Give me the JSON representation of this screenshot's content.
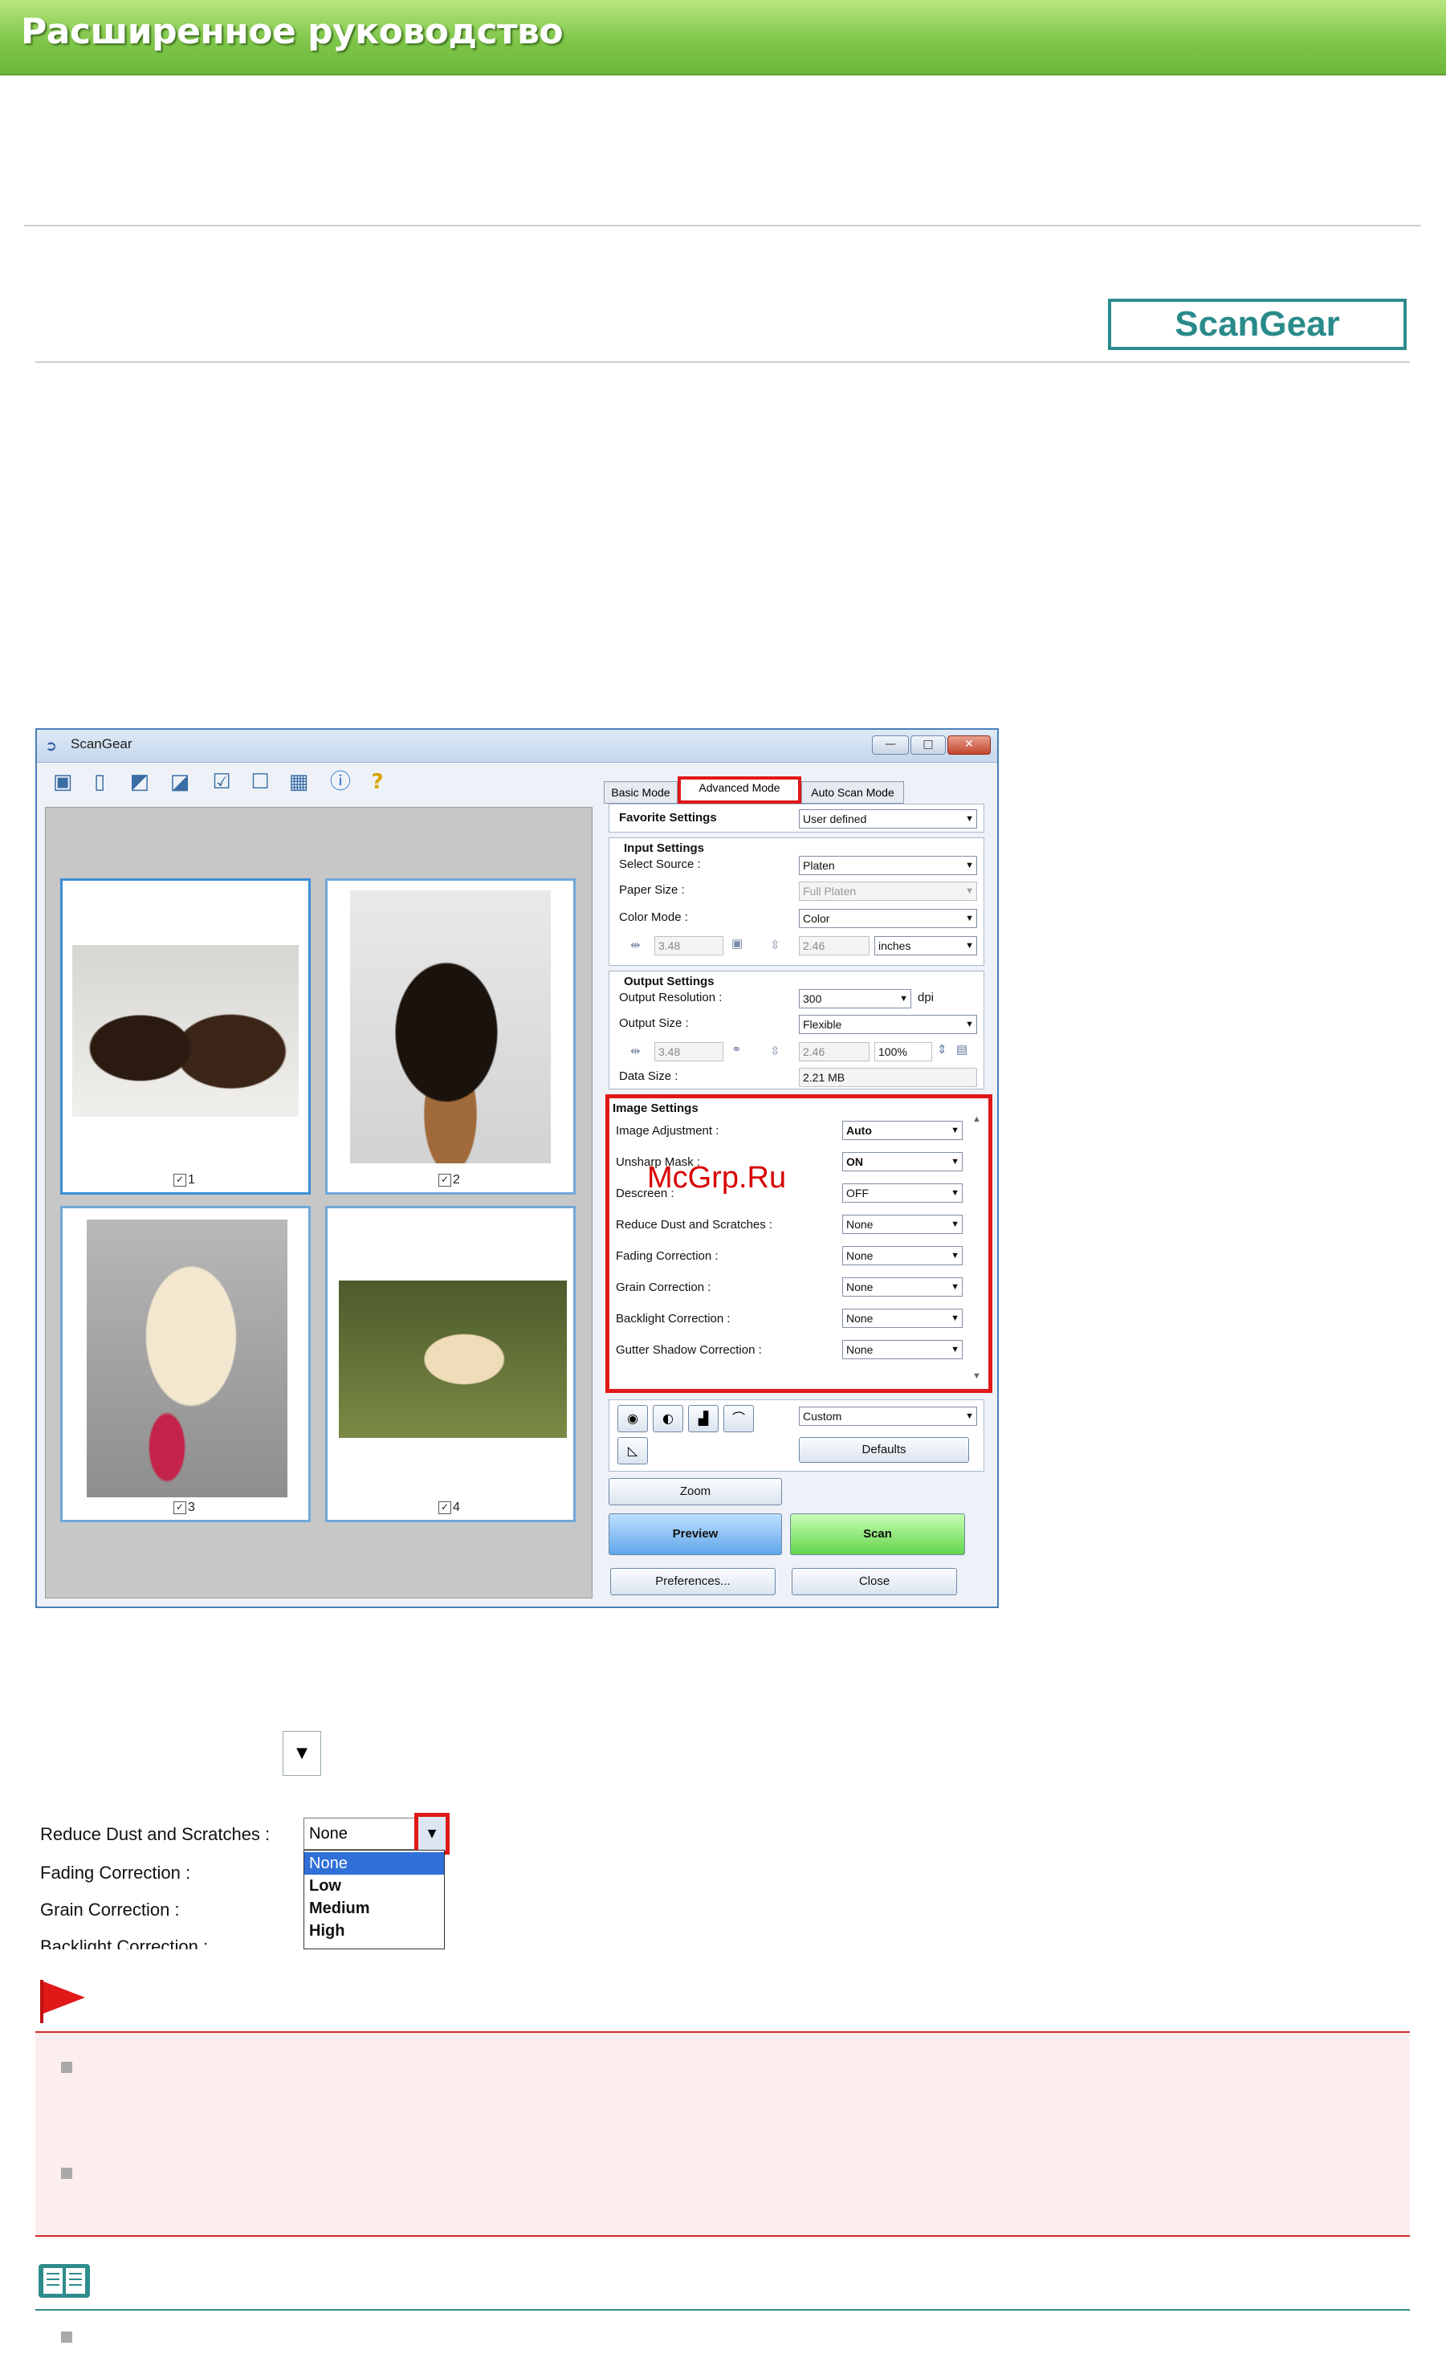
{
  "header": {
    "title": "Расширенное руководство"
  },
  "badge": {
    "label": "ScanGear"
  },
  "window": {
    "title": "ScanGear",
    "tabs": [
      "Basic Mode",
      "Advanced Mode",
      "Auto Scan Mode"
    ],
    "thumbnails": [
      {
        "check": "1"
      },
      {
        "check": "2"
      },
      {
        "check": "3"
      },
      {
        "check": "4"
      }
    ],
    "favorite": {
      "label": "Favorite Settings",
      "value": "User defined"
    },
    "input_settings": {
      "heading": "Input Settings",
      "select_source": {
        "label": "Select Source :",
        "value": "Platen"
      },
      "paper_size": {
        "label": "Paper Size :",
        "value": "Full Platen"
      },
      "color_mode": {
        "label": "Color Mode :",
        "value": "Color"
      },
      "width": "3.48",
      "height": "2.46",
      "unit": "inches"
    },
    "output_settings": {
      "heading": "Output Settings",
      "resolution": {
        "label": "Output Resolution :",
        "value": "300",
        "unit": "dpi"
      },
      "size": {
        "label": "Output Size :",
        "value": "Flexible"
      },
      "width": "3.48",
      "height": "2.46",
      "scale": "100%",
      "data_size": {
        "label": "Data Size :",
        "value": "2.21 MB"
      }
    },
    "image_settings": {
      "heading": "Image Settings",
      "rows": [
        {
          "label": "Image Adjustment :",
          "value": "Auto"
        },
        {
          "label": "Unsharp Mask :",
          "value": "ON"
        },
        {
          "label": "Descreen :",
          "value": "OFF"
        },
        {
          "label": "Reduce Dust and Scratches :",
          "value": "None"
        },
        {
          "label": "Fading Correction :",
          "value": "None"
        },
        {
          "label": "Grain Correction :",
          "value": "None"
        },
        {
          "label": "Backlight Correction :",
          "value": "None"
        },
        {
          "label": "Gutter Shadow Correction :",
          "value": "None"
        }
      ]
    },
    "tone": {
      "value": "Custom",
      "defaults": "Defaults"
    },
    "buttons": {
      "zoom": "Zoom",
      "preview": "Preview",
      "scan": "Scan",
      "preferences": "Preferences...",
      "close": "Close"
    }
  },
  "watermark": "McGrp.Ru",
  "dropdown_demo": {
    "labels": [
      "Reduce Dust and Scratches :",
      "Fading Correction :",
      "Grain Correction :",
      "Backlight Correction :"
    ],
    "value": "None",
    "options": [
      "None",
      "Low",
      "Medium",
      "High"
    ]
  },
  "colors": {
    "banner": "#7fc64a",
    "highlight": "#e01818",
    "badge": "#2f8c8c",
    "important_bg": "#fceeee"
  }
}
